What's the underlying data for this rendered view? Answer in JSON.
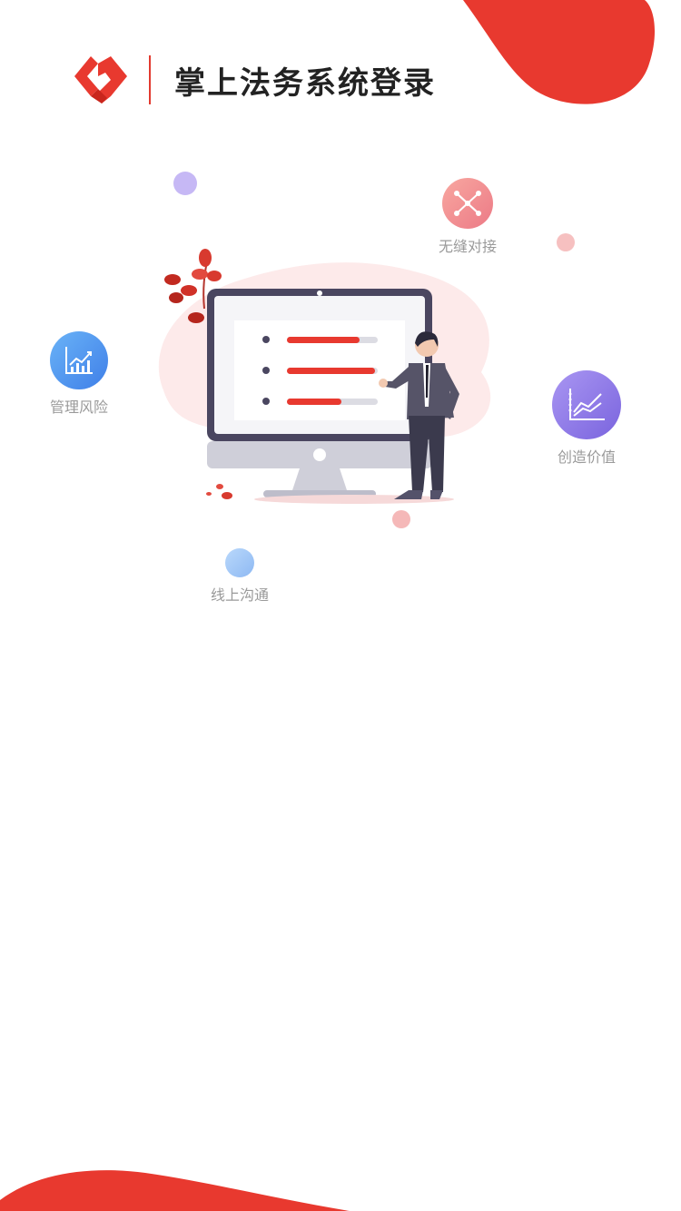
{
  "header": {
    "title": "掌上法务系统登录",
    "logo_icon": "brand-logo-icon"
  },
  "colors": {
    "brand_red": "#e8392f",
    "text_dark": "#222222",
    "label_gray": "#9a9a9a"
  },
  "features": [
    {
      "label": "无缝对接",
      "icon": "network-nodes-icon",
      "color": "#f08a8a"
    },
    {
      "label": "管理风险",
      "icon": "bar-chart-icon",
      "color": "#4f8ff0"
    },
    {
      "label": "创造价值",
      "icon": "line-chart-icon",
      "color": "#8a78e8"
    },
    {
      "label": "线上沟通",
      "icon": "chat-dot-icon",
      "color": "#9cc6f7"
    }
  ],
  "hero": {
    "progress": [
      {
        "icon": "hourglass-icon",
        "value": 0.8
      },
      {
        "icon": "rocket-icon",
        "value": 0.97
      },
      {
        "icon": "speedometer-icon",
        "value": 0.6
      }
    ]
  }
}
